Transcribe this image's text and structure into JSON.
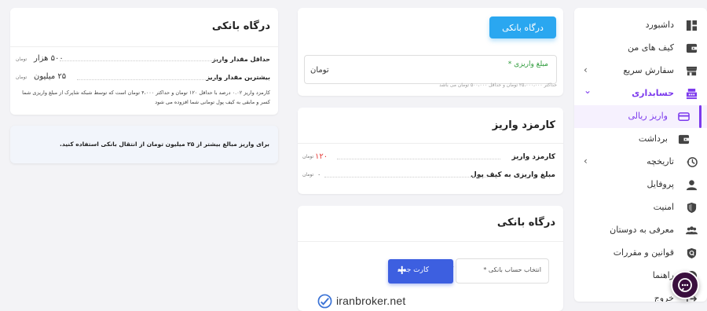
{
  "sidebar": {
    "items": [
      {
        "label": "داشبورد",
        "icon": "dashboard-icon"
      },
      {
        "label": "کیف های من",
        "icon": "wallet-icon"
      },
      {
        "label": "سفارش سریع",
        "icon": "store-icon",
        "chevron": "›"
      },
      {
        "label": "حسابداری",
        "icon": "cash-register-icon",
        "chevron": "⌄"
      },
      {
        "label": "واریز ریالی",
        "icon": "credit-card-icon"
      },
      {
        "label": "برداشت",
        "icon": "wallet-withdraw-icon"
      },
      {
        "label": "تاریخچه",
        "icon": "history-icon",
        "chevron": "›"
      },
      {
        "label": "پروفایل",
        "icon": "user-icon"
      },
      {
        "label": "امنیت",
        "icon": "shield-icon"
      },
      {
        "label": "معرفی به دوستان",
        "icon": "group-icon"
      },
      {
        "label": "قوانین و مقررات",
        "icon": "rules-shield-icon"
      },
      {
        "label": "راهنما",
        "icon": "help-icon"
      },
      {
        "label": "خروج",
        "icon": "logout-icon"
      }
    ]
  },
  "gateway_top": {
    "button_label": "درگاه بانکی",
    "amount_label": "مبلغ واریزی *",
    "currency": "تومان",
    "hint": "حداکثر ۲۵،۰۰۰،۰۰۰ تومان و حداقل ۵۰۰،۰۰۰ تومان می باشد"
  },
  "fee": {
    "title": "کارمزد واریز",
    "fee_label": "کارمزد واریز",
    "fee_value": "۱۲۰",
    "fee_unit": "تومان",
    "wallet_label": "مبلغ واریزی به کیف پول",
    "wallet_value": "۰",
    "wallet_unit": "تومان"
  },
  "gateway_bottom": {
    "title": "درگاه بانکی",
    "select_placeholder": "انتخاب حساب بانکی *",
    "new_card_label": "کارت جدید"
  },
  "info": {
    "title": "درگاه بانکی",
    "min_label": "حداقل مقدار واریز",
    "min_value": "۵۰۰ هزار",
    "min_unit": "تومان",
    "max_label": "بیشترین مقدار واریز",
    "max_value": "۲۵ میلیون",
    "max_unit": "تومان",
    "description": "کارمزد واریز ۰.۰۲ درصد با حداقل ۱۲۰ تومان و حداکثر ۴،۰۰۰ تومان است که توسط شبکه شاپرک از مبلغ واریزی شما کسر و مابقی به کیف پول تومانی شما افزوده می شود"
  },
  "alert": {
    "text": "برای واریز مبالغ بیشتر از ۲۵ میلیون تومان از انتقال بانکی استفاده کنید."
  },
  "watermark": {
    "text": "iranbroker.net"
  },
  "colors": {
    "accent": "#7c3aed",
    "primary": "#2aa7f0",
    "button_blue": "#3d5fe0",
    "fee_red": "#e53935",
    "chat_bg": "#3a0f3e"
  }
}
